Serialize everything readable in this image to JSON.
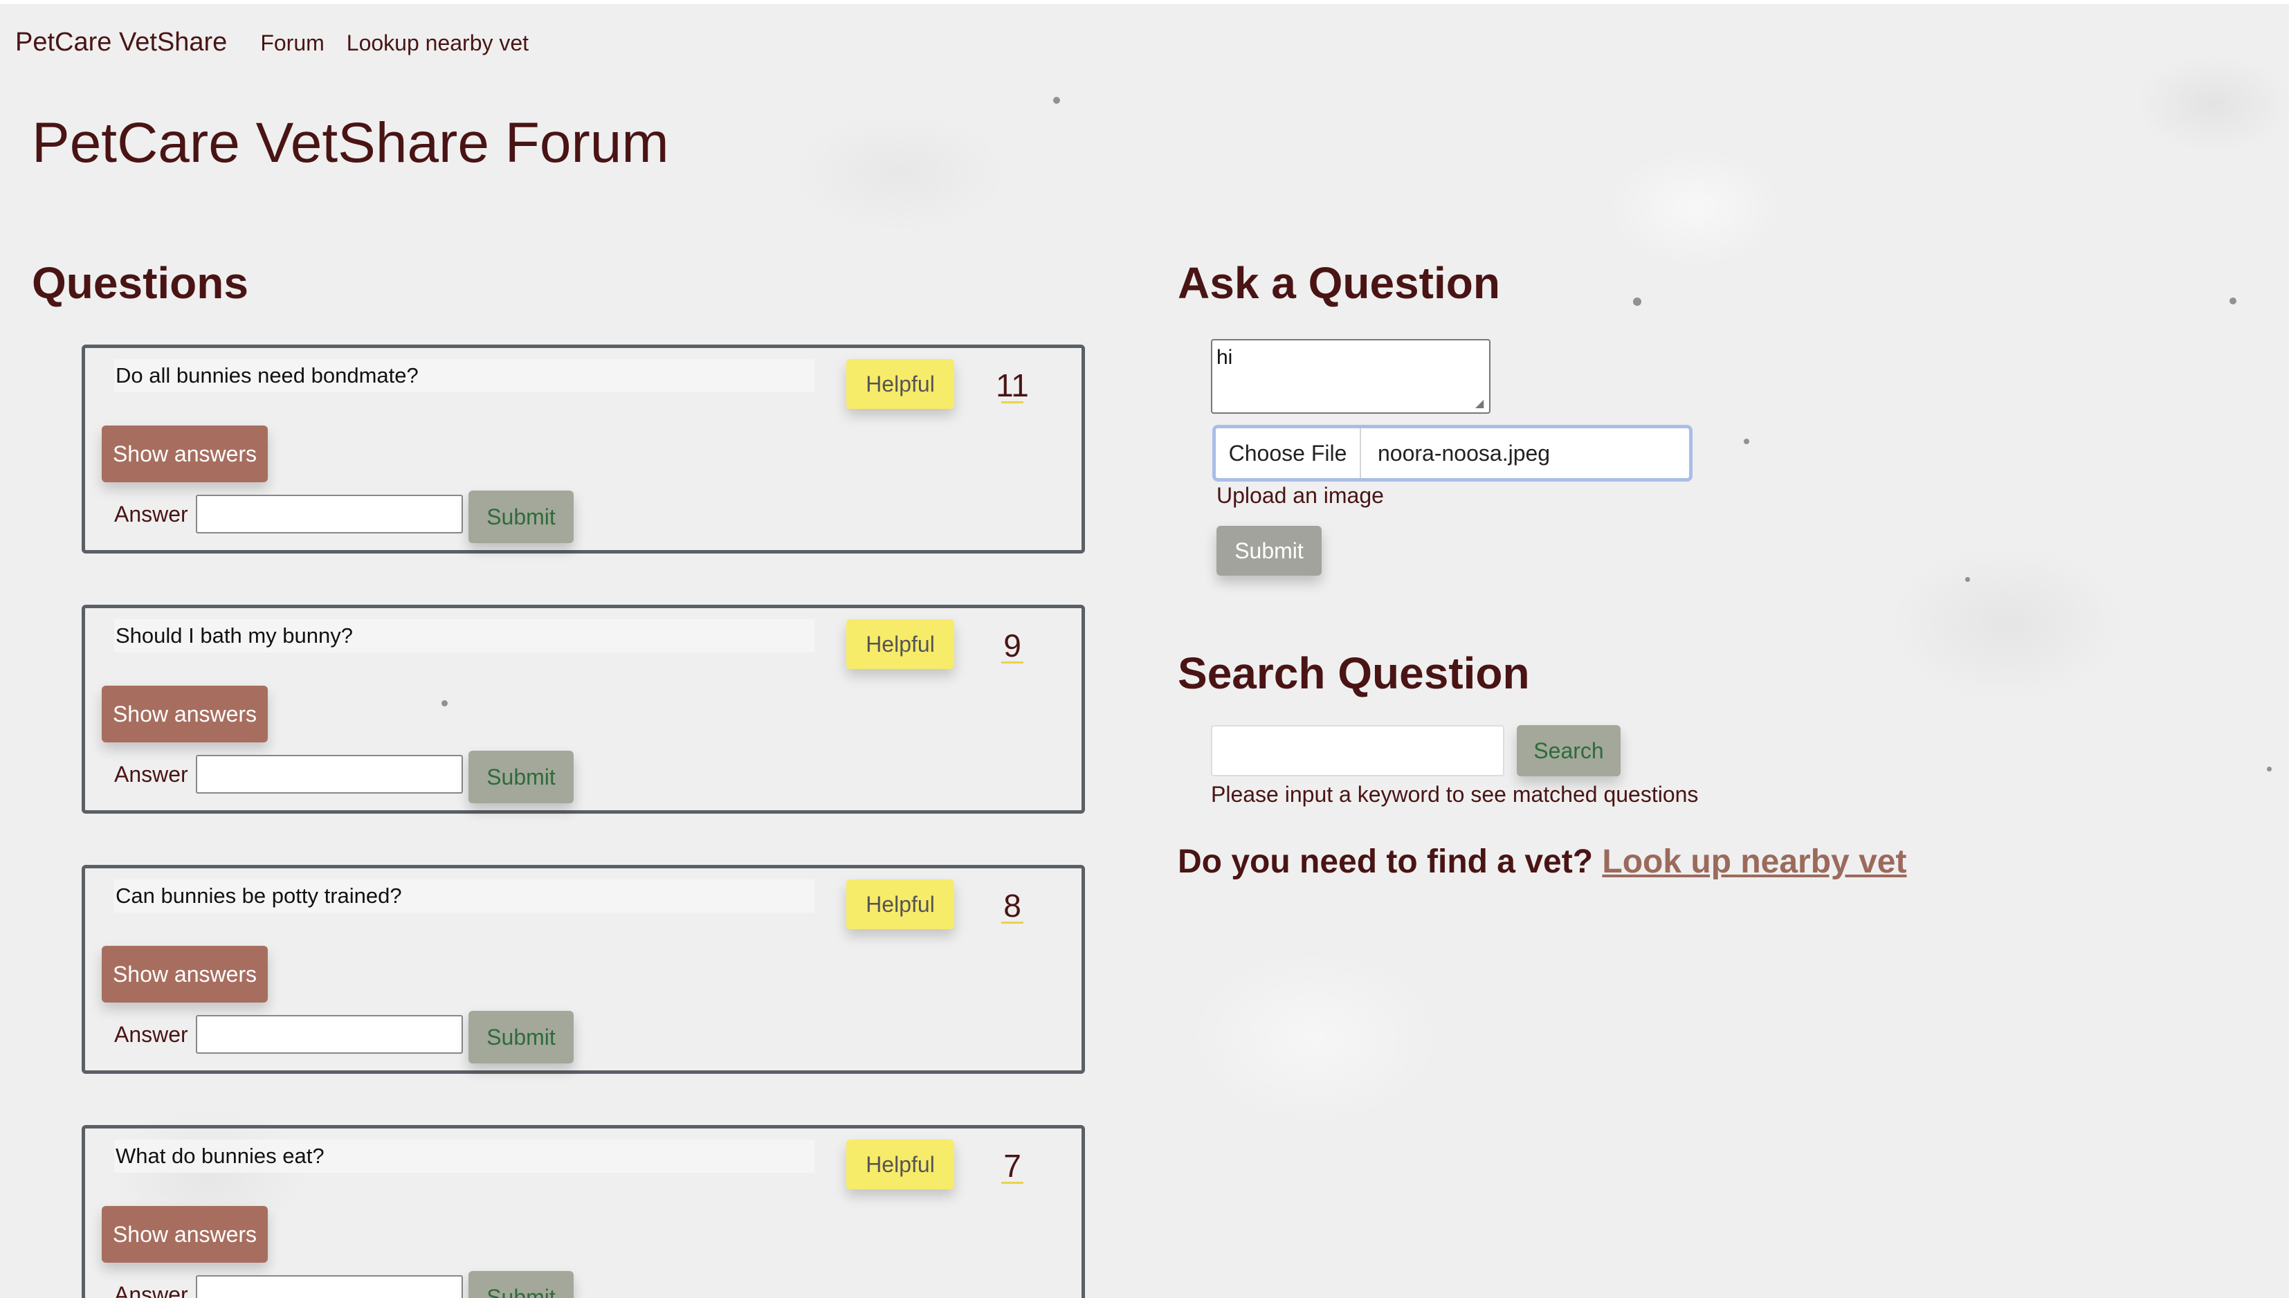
{
  "nav": {
    "brand": "PetCare VetShare",
    "links": [
      "Forum",
      "Lookup nearby vet"
    ]
  },
  "page_title": "PetCare VetShare Forum",
  "questions_section": {
    "title": "Questions",
    "items": [
      {
        "text": "Do all bunnies need bondmate?",
        "helpful_label": "Helpful",
        "count": "11",
        "show_answers_label": "Show answers",
        "answer_label": "Answer",
        "submit_label": "Submit"
      },
      {
        "text": "Should I bath my bunny?",
        "helpful_label": "Helpful",
        "count": "9",
        "show_answers_label": "Show answers",
        "answer_label": "Answer",
        "submit_label": "Submit"
      },
      {
        "text": "Can bunnies be potty trained?",
        "helpful_label": "Helpful",
        "count": "8",
        "show_answers_label": "Show answers",
        "answer_label": "Answer",
        "submit_label": "Submit"
      },
      {
        "text": "What do bunnies eat?",
        "helpful_label": "Helpful",
        "count": "7",
        "show_answers_label": "Show answers",
        "answer_label": "Answer",
        "submit_label": "Submit"
      }
    ]
  },
  "ask_section": {
    "title": "Ask a Question",
    "textarea_value": "hi",
    "choose_file_label": "Choose File",
    "file_name": "noora-noosa.jpeg",
    "upload_hint": "Upload an image",
    "submit_label": "Submit"
  },
  "search_section": {
    "title": "Search Question",
    "input_value": "",
    "button_label": "Search",
    "hint": "Please input a keyword to see matched questions"
  },
  "vet_prompt": {
    "question": "Do you need to find a vet?",
    "link_label": "Look up nearby vet"
  },
  "colors": {
    "text_primary": "#4a1414",
    "helpful_yellow": "#f7eb6a",
    "show_answers_brown": "#a76e5f",
    "submit_gray": "#a3a89a",
    "submit_green_text": "#2e6b3a",
    "link_brown": "#9b6a5c",
    "file_focus_blue": "#a9bde8"
  }
}
